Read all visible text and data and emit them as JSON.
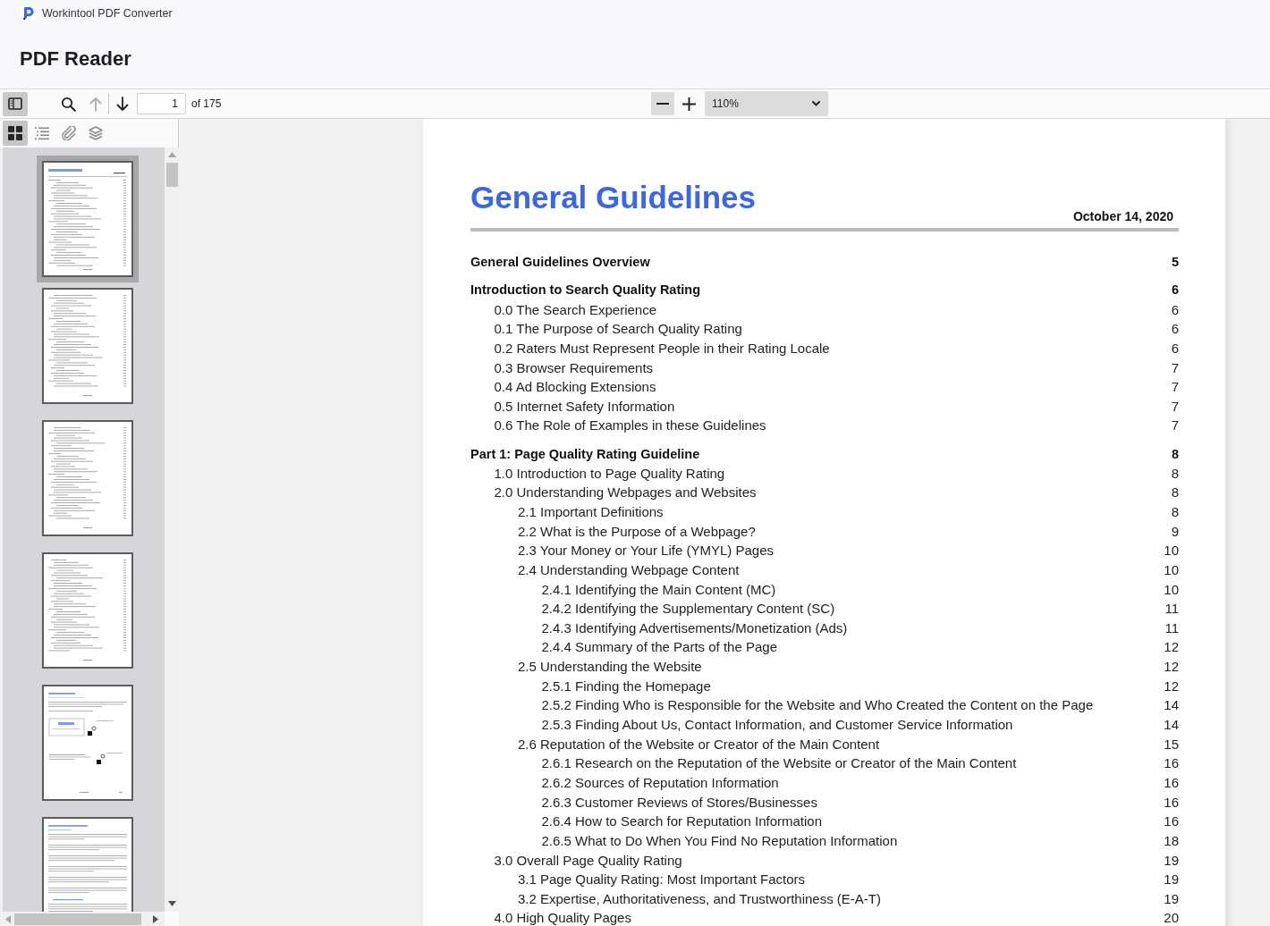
{
  "window": {
    "title": "Workintool PDF Converter"
  },
  "header": {
    "title": "PDF Reader"
  },
  "toolbar": {
    "sidebar_toggle": {
      "on": true
    },
    "previous_page": {
      "disabled": true
    },
    "next_page": {
      "disabled": false
    },
    "page_field": {
      "value": "1"
    },
    "page_count": "of 175",
    "zoom_out": {
      "highlighted": true
    },
    "zoom_in": {
      "highlighted": false
    },
    "zoom_select": {
      "value": "110%"
    }
  },
  "sidebar": {
    "tabs": [
      {
        "kind": "thumbnails",
        "selected": true
      },
      {
        "kind": "outline",
        "selected": false
      },
      {
        "kind": "attachments",
        "selected": false
      },
      {
        "kind": "layers",
        "selected": false
      }
    ],
    "thumbnails": [
      {
        "kind": "title-contents",
        "selected": true
      },
      {
        "kind": "contents",
        "selected": false
      },
      {
        "kind": "contents",
        "selected": false
      },
      {
        "kind": "contents",
        "selected": false
      },
      {
        "kind": "figure",
        "selected": false
      },
      {
        "kind": "article",
        "selected": false
      }
    ]
  },
  "document": {
    "title": "General Guidelines",
    "date": "October 14, 2020",
    "contents": [
      {
        "label": "General Guidelines Overview",
        "page": "5"
      },
      {
        "label": "Introduction to Search Quality Rating",
        "page": "6",
        "children": [
          {
            "label": "0.0 The Search Experience",
            "page": "6"
          },
          {
            "label": "0.1 The Purpose of Search Quality Rating",
            "page": "6"
          },
          {
            "label": "0.2 Raters Must Represent People in their Rating Locale",
            "page": "6"
          },
          {
            "label": "0.3 Browser Requirements",
            "page": "7"
          },
          {
            "label": "0.4 Ad Blocking Extensions",
            "page": "7"
          },
          {
            "label": "0.5 Internet Safety Information",
            "page": "7"
          },
          {
            "label": "0.6 The Role of Examples in these Guidelines",
            "page": "7"
          }
        ]
      },
      {
        "label": "Part 1: Page Quality Rating Guideline",
        "page": "8",
        "children": [
          {
            "label": "1.0 Introduction to Page Quality Rating",
            "page": "8"
          },
          {
            "label": "2.0 Understanding Webpages and Websites",
            "page": "8",
            "children": [
              {
                "label": "2.1 Important Definitions",
                "page": "8"
              },
              {
                "label": "2.2 What is the Purpose of a Webpage?",
                "page": "9"
              },
              {
                "label": "2.3 Your Money or Your Life (YMYL) Pages",
                "page": "10"
              },
              {
                "label": "2.4 Understanding Webpage Content",
                "page": "10",
                "children": [
                  {
                    "label": "2.4.1 Identifying the Main Content (MC)",
                    "page": "10"
                  },
                  {
                    "label": "2.4.2 Identifying the Supplementary Content (SC)",
                    "page": "11"
                  },
                  {
                    "label": "2.4.3 Identifying Advertisements/Monetization (Ads)",
                    "page": "11"
                  },
                  {
                    "label": "2.4.4 Summary of the Parts of the Page",
                    "page": "12"
                  }
                ]
              },
              {
                "label": "2.5 Understanding the Website",
                "page": "12",
                "children": [
                  {
                    "label": "2.5.1 Finding the Homepage",
                    "page": "12"
                  },
                  {
                    "label": "2.5.2 Finding Who is Responsible for the Website and Who Created the Content on the Page",
                    "page": "14"
                  },
                  {
                    "label": "2.5.3 Finding About Us, Contact Information, and Customer Service Information",
                    "page": "14"
                  }
                ]
              },
              {
                "label": "2.6 Reputation of the Website or Creator of the Main Content",
                "page": "15",
                "children": [
                  {
                    "label": "2.6.1 Research on the Reputation of the Website or Creator of the Main Content",
                    "page": "16"
                  },
                  {
                    "label": "2.6.2 Sources of Reputation Information",
                    "page": "16"
                  },
                  {
                    "label": "2.6.3 Customer Reviews of Stores/Businesses",
                    "page": "16"
                  },
                  {
                    "label": "2.6.4 How to Search for Reputation Information",
                    "page": "16"
                  },
                  {
                    "label": "2.6.5 What to Do When You Find No Reputation Information",
                    "page": "18"
                  }
                ]
              }
            ]
          },
          {
            "label": "3.0 Overall Page Quality Rating",
            "page": "19",
            "children": [
              {
                "label": "3.1 Page Quality Rating: Most Important Factors",
                "page": "19"
              },
              {
                "label": "3.2 Expertise, Authoritativeness, and Trustworthiness (E-A-T)",
                "page": "19"
              }
            ]
          },
          {
            "label": "4.0 High Quality Pages",
            "page": "20"
          }
        ]
      }
    ]
  }
}
